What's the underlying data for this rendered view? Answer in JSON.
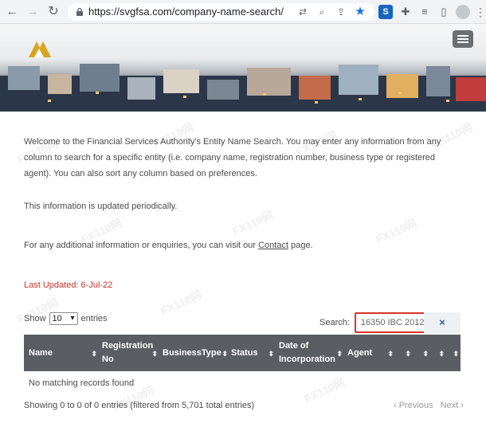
{
  "browser": {
    "url": "https://svgfsa.com/company-name-search/",
    "back_glyph": "←",
    "forward_glyph": "→",
    "reload_glyph": "↻"
  },
  "content": {
    "intro": "Welcome to the Financial Services Authority's Entity Name Search. You may enter any information from any column to search for a specific entity (i.e. company name, registration number, business type or registered agent). You can also sort any column based on preferences.",
    "periodic": "This information is updated periodically.",
    "contact_prefix": "For any additional information or enquiries, you can visit our ",
    "contact_link": "Contact",
    "contact_suffix": " page.",
    "last_updated": "Last Updated:  6-Jul-22"
  },
  "table_controls": {
    "show_label": "Show",
    "entries_value": "10",
    "entries_label": "entries",
    "search_label": "Search:",
    "search_value": "16350 IBC 2012",
    "clear_glyph": "×"
  },
  "table": {
    "headers": {
      "name": "Name",
      "registration_no": "Registration No",
      "business_type": "BusinessType",
      "status": "Status",
      "date_of_incorporation": "Date of Incorporation",
      "agent": "Agent"
    },
    "empty_message": "No matching records found"
  },
  "footer": {
    "info": "Showing 0 to 0 of 0 entries (filtered from 5,701 total entries)",
    "previous": "‹ Previous",
    "next": "Next ›"
  },
  "watermark": "FX110网",
  "icons": {
    "lock": "lock-icon",
    "translate": "translate-icon",
    "zoom": "zoom-icon",
    "share": "share-icon",
    "bookmark": "star-icon",
    "extensions": "puzzle-icon",
    "menu": "hamburger-icon"
  },
  "colors": {
    "accent_red": "#d9342b",
    "table_header": "#5a5e62",
    "bookmark_blue": "#1a73e8"
  }
}
